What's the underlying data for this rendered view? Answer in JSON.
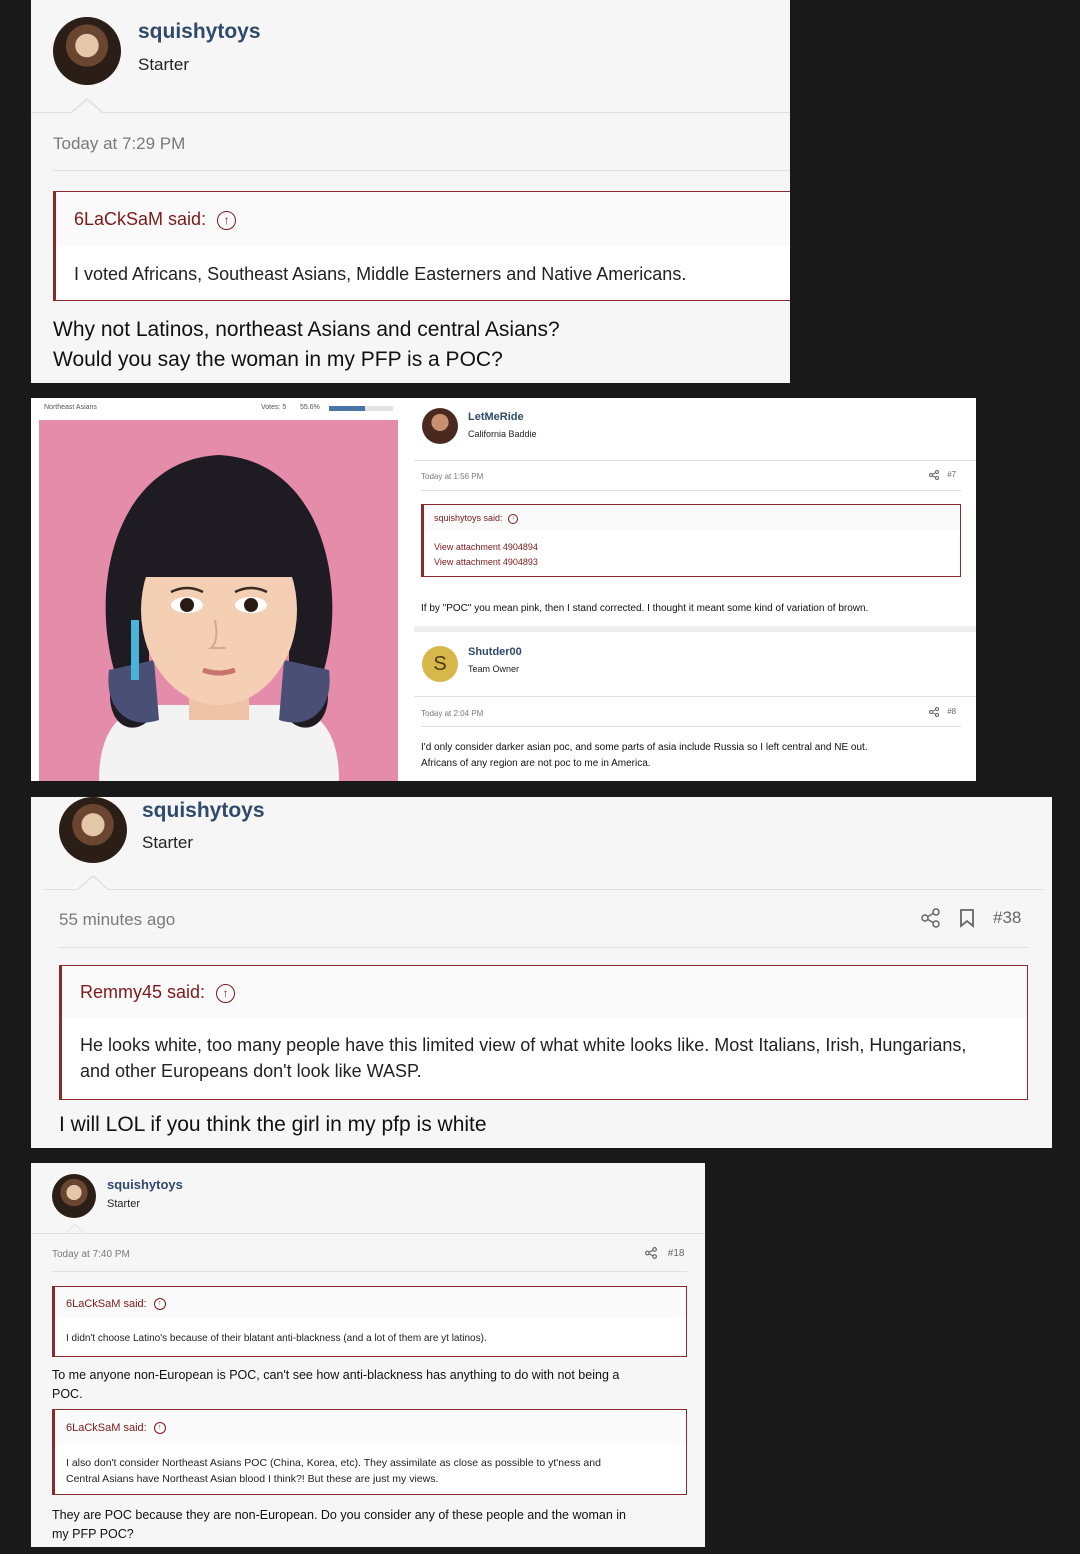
{
  "post1": {
    "username": "squishytoys",
    "user_title": "Starter",
    "timestamp": "Today at 7:29 PM",
    "quote_author": "6LaCkSaM said:",
    "quote_text": "I voted Africans, Southeast Asians, Middle Easterners and Native Americans.",
    "message_line1": "Why not Latinos, northeast Asians and central Asians?",
    "message_line2": "Would you say the woman in my PFP is a POC?"
  },
  "post2": {
    "image_header_left": "Northeast Asians",
    "image_header_votes": "Votes: 5",
    "image_header_pct": "55.6%",
    "vote_fraction": 0.556,
    "reply1": {
      "username": "LetMeRide",
      "user_title": "California Baddie",
      "timestamp": "Today at 1:56 PM",
      "post_number": "#7",
      "quote_author": "squishytoys said:",
      "attachment1": "View attachment 4904894",
      "attachment2": "View attachment 4904893",
      "message": "If by \"POC\" you mean pink, then I stand corrected. I thought it meant some kind of variation of brown."
    },
    "reply2": {
      "username": "Shutder00",
      "avatar_letter": "S",
      "user_title": "Team Owner",
      "timestamp": "Today at 2:04 PM",
      "post_number": "#8",
      "message_line1": "I'd only consider darker asian poc, and some parts of asia include Russia so I left central and NE out.",
      "message_line2": "Africans of any region are not poc to me in America."
    }
  },
  "post3": {
    "username": "squishytoys",
    "user_title": "Starter",
    "timestamp": "55 minutes ago",
    "post_number": "#38",
    "quote_author": "Remmy45 said:",
    "quote_line1": "He looks white, too many people have this limited view of what white looks like. Most Italians, Irish, Hungarians,",
    "quote_line2": "and other Europeans don't look like WASP.",
    "message": "I will LOL if you think the girl in my pfp is white"
  },
  "post4": {
    "username": "squishytoys",
    "user_title": "Starter",
    "timestamp": "Today at 7:40 PM",
    "post_number": "#18",
    "quote1_author": "6LaCkSaM said:",
    "quote1_text": "I didn't choose Latino's because of their blatant anti-blackness (and a lot of them are yt latinos).",
    "message1_line1": "To me anyone non-European is POC, can't see how anti-blackness has anything to do with not being a",
    "message1_line2": "POC.",
    "quote2_author": "6LaCkSaM said:",
    "quote2_line1": "I also don't consider Northeast Asians POC (China, Korea, etc). They assimilate as close as possible to yt'ness and",
    "quote2_line2": "Central Asians have Northeast Asian blood I think?! But these are just my views.",
    "message2_line1": "They are POC because they are non-European. Do you consider any of these people and the woman in",
    "message2_line2": "my PFP POC?"
  },
  "colors": {
    "background": "#191919",
    "panel": "#f6f6f6",
    "quote_border": "#8b2a2a",
    "quote_name": "#7c1a1a",
    "username": "#2f4a6b",
    "photo_background": "#e58cab"
  },
  "icons": [
    "up-arrow-circle-icon",
    "share-icon",
    "bookmark-icon"
  ],
  "up_arrow_glyph": "↑"
}
